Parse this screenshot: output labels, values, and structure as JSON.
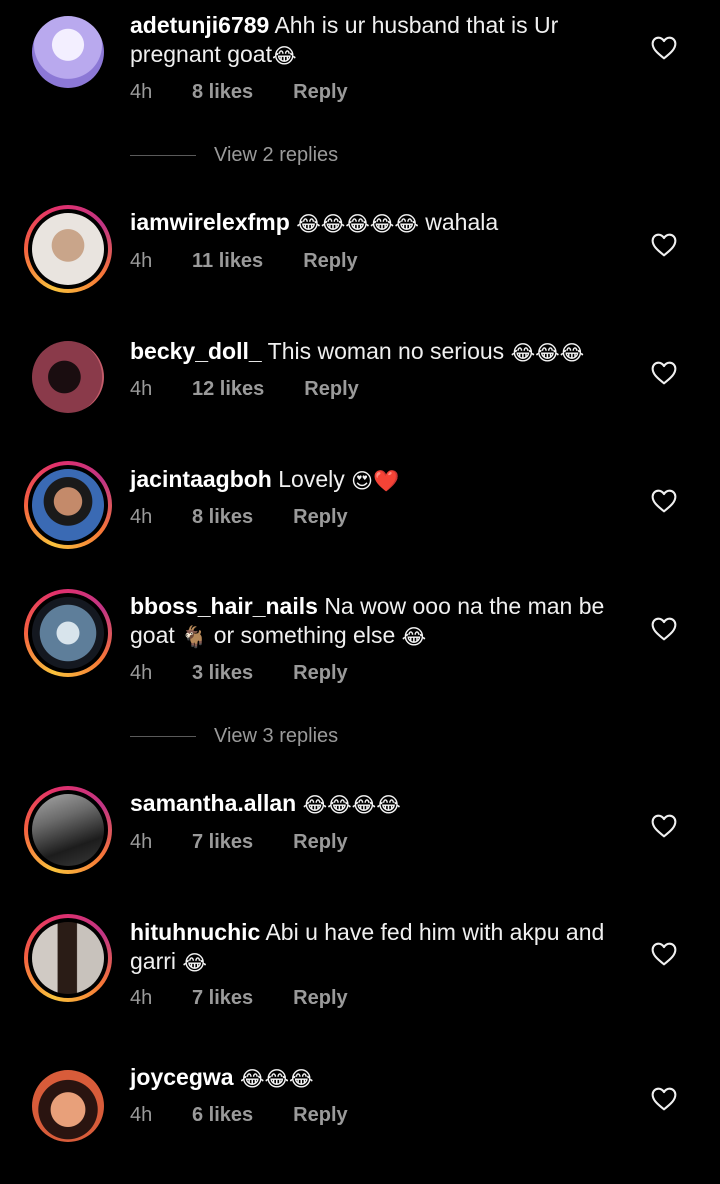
{
  "comments": [
    {
      "username": "adetunji6789",
      "text": "Ahh is ur husband that is Ur pregnant goat",
      "emoji": "😂",
      "time": "4h",
      "likes": "8 likes",
      "reply": "Reply",
      "avatar_colors": [
        "#c9b8f0",
        "#7a68c4"
      ]
    },
    {
      "username": "iamwirelexfmp",
      "text": "",
      "emoji": "😂😂😂😂😂",
      "text_after": "wahala",
      "time": "4h",
      "likes": "11 likes",
      "reply": "Reply",
      "avatar_colors": [
        "#e8e2dc",
        "#b89a86"
      ]
    },
    {
      "username": "becky_doll_",
      "text": "This woman no serious",
      "emoji": "😂😂😂",
      "time": "4h",
      "likes": "12 likes",
      "reply": "Reply",
      "avatar_colors": [
        "#6b2a3a",
        "#2a1218"
      ]
    },
    {
      "username": "jacintaagboh",
      "text": "Lovely",
      "emoji": "😍❤️",
      "time": "4h",
      "likes": "8 likes",
      "reply": "Reply",
      "avatar_colors": [
        "#4a6fb8",
        "#1d2a4a"
      ]
    },
    {
      "username": "bboss_hair_nails",
      "text": "Na wow ooo na the man be goat",
      "emoji": "🐐",
      "text_after": "or something else",
      "emoji_after": "😂",
      "time": "4h",
      "likes": "3 likes",
      "reply": "Reply",
      "avatar_colors": [
        "#7fa2c4",
        "#1a2230"
      ]
    },
    {
      "username": "samantha.allan",
      "text": "",
      "emoji": "😂😂😂😂",
      "time": "4h",
      "likes": "7 likes",
      "reply": "Reply",
      "avatar_colors": [
        "#9a9a9a",
        "#2a2a2a"
      ]
    },
    {
      "username": "hituhnuchic",
      "text": "Abi u have fed him with akpu and garri",
      "emoji": "😂",
      "time": "4h",
      "likes": "7 likes",
      "reply": "Reply",
      "avatar_colors": [
        "#c8c2bc",
        "#3a2a22"
      ]
    },
    {
      "username": "joycegwa",
      "text": "",
      "emoji": "😂😂😂",
      "time": "4h",
      "likes": "6 likes",
      "reply": "Reply",
      "avatar_colors": [
        "#d88a5a",
        "#3a1a10"
      ]
    }
  ],
  "view_replies": [
    "View 2 replies",
    "View 3 replies"
  ],
  "icons": {
    "like": "heart-outline-icon"
  },
  "colors": {
    "background": "#000000",
    "meta_text": "#9a9a9a",
    "ring_gradient": [
      "#f9c23c",
      "#e1306c",
      "#c13584"
    ]
  }
}
